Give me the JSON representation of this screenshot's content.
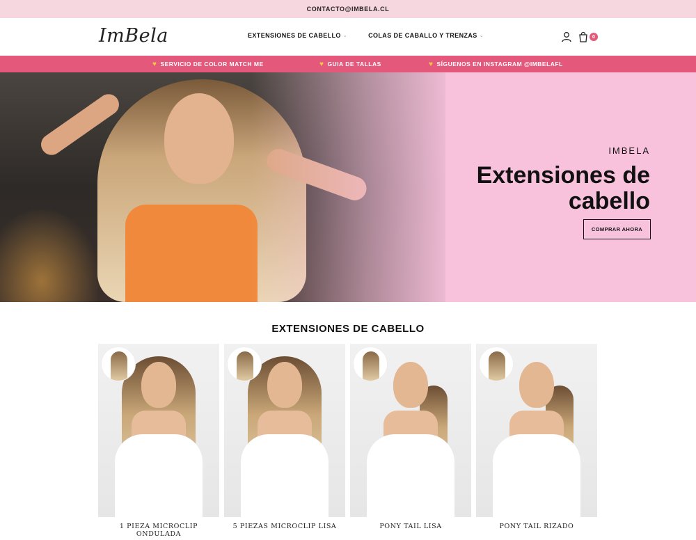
{
  "topbar": {
    "contact": "CONTACTO@IMBELA.CL"
  },
  "header": {
    "logo": "ImBela",
    "nav": [
      {
        "label": "EXTENSIONES DE CABELLO"
      },
      {
        "label": "COLAS DE CABALLO Y TRENZAS"
      }
    ],
    "cart_count": "0"
  },
  "promo": {
    "items": [
      {
        "label": "SERVICIO DE COLOR MATCH ME"
      },
      {
        "label": "GUIA DE TALLAS"
      },
      {
        "label": "SÍGUENOS EN INSTAGRAM @IMBELAFL"
      }
    ]
  },
  "hero": {
    "subtitle": "IMBELA",
    "title": "Extensiones de cabello",
    "button": "COMPRAR AHORA"
  },
  "section": {
    "title": "EXTENSIONES DE CABELLO",
    "products": [
      {
        "name": "1 PIEZA MICROCLIP ONDULADA"
      },
      {
        "name": "5 PIEZAS MICROCLIP LISA"
      },
      {
        "name": "PONY TAIL LISA"
      },
      {
        "name": "PONY TAIL RIZADO"
      }
    ]
  },
  "colors": {
    "accent": "#e4587b",
    "hero_bg": "#f8c2dd",
    "topbar_bg": "#f6d6df"
  }
}
